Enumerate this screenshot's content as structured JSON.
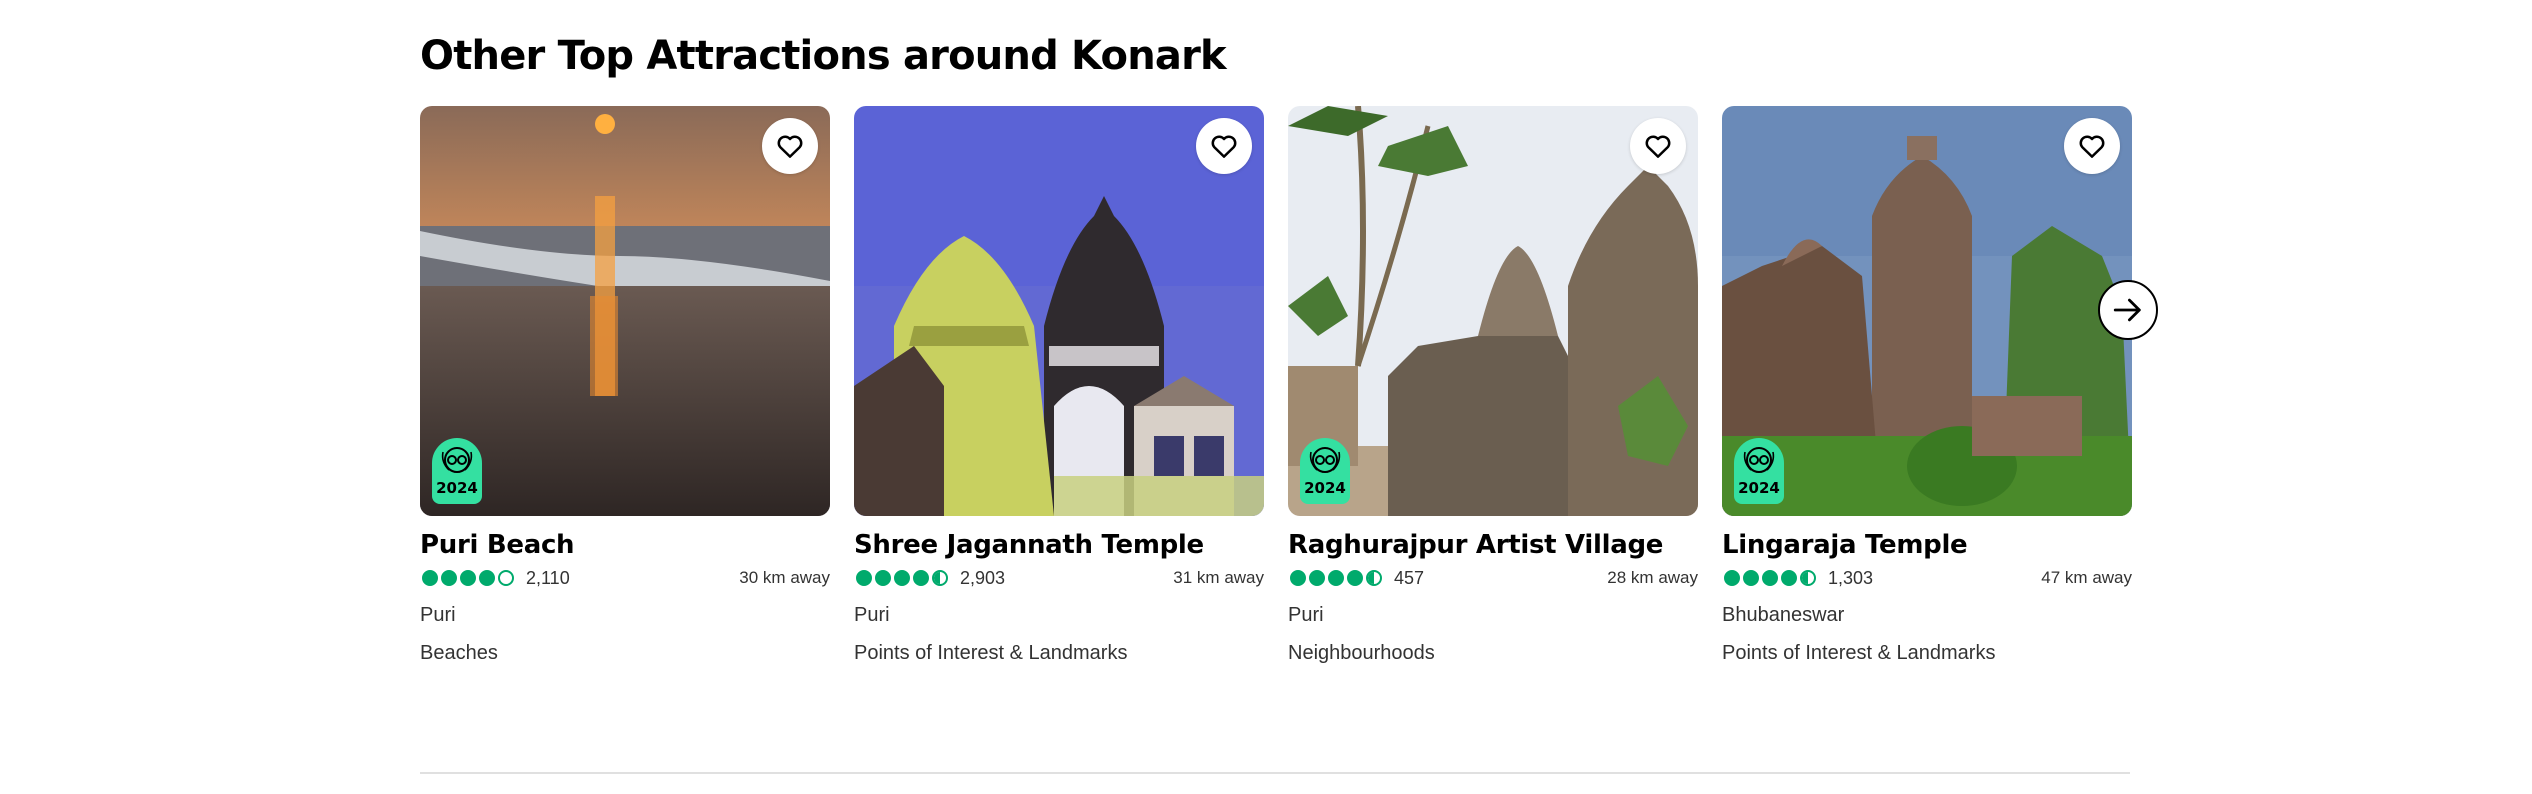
{
  "section": {
    "title": "Other Top Attractions around Konark"
  },
  "cards": [
    {
      "title": "Puri Beach",
      "rating": 4,
      "reviews": "2,110",
      "distance": "30 km away",
      "location": "Puri",
      "category": "Beaches",
      "award_year": "2024"
    },
    {
      "title": "Shree Jagannath Temple",
      "rating": 4.5,
      "reviews": "2,903",
      "distance": "31 km away",
      "location": "Puri",
      "category": "Points of Interest & Landmarks",
      "award_year": ""
    },
    {
      "title": "Raghurajpur Artist Village",
      "rating": 4.5,
      "reviews": "457",
      "distance": "28 km away",
      "location": "Puri",
      "category": "Neighbourhoods",
      "award_year": "2024"
    },
    {
      "title": "Lingaraja Temple",
      "rating": 4.5,
      "reviews": "1,303",
      "distance": "47 km away",
      "location": "Bhubaneswar",
      "category": "Points of Interest & Landmarks",
      "award_year": "2024"
    }
  ],
  "colors": {
    "bubble": "#00aa6c",
    "badge": "#34e0a1"
  },
  "icons": {
    "favorite": "heart-icon",
    "next": "arrow-right-icon",
    "award": "travellers-choice-icon"
  }
}
